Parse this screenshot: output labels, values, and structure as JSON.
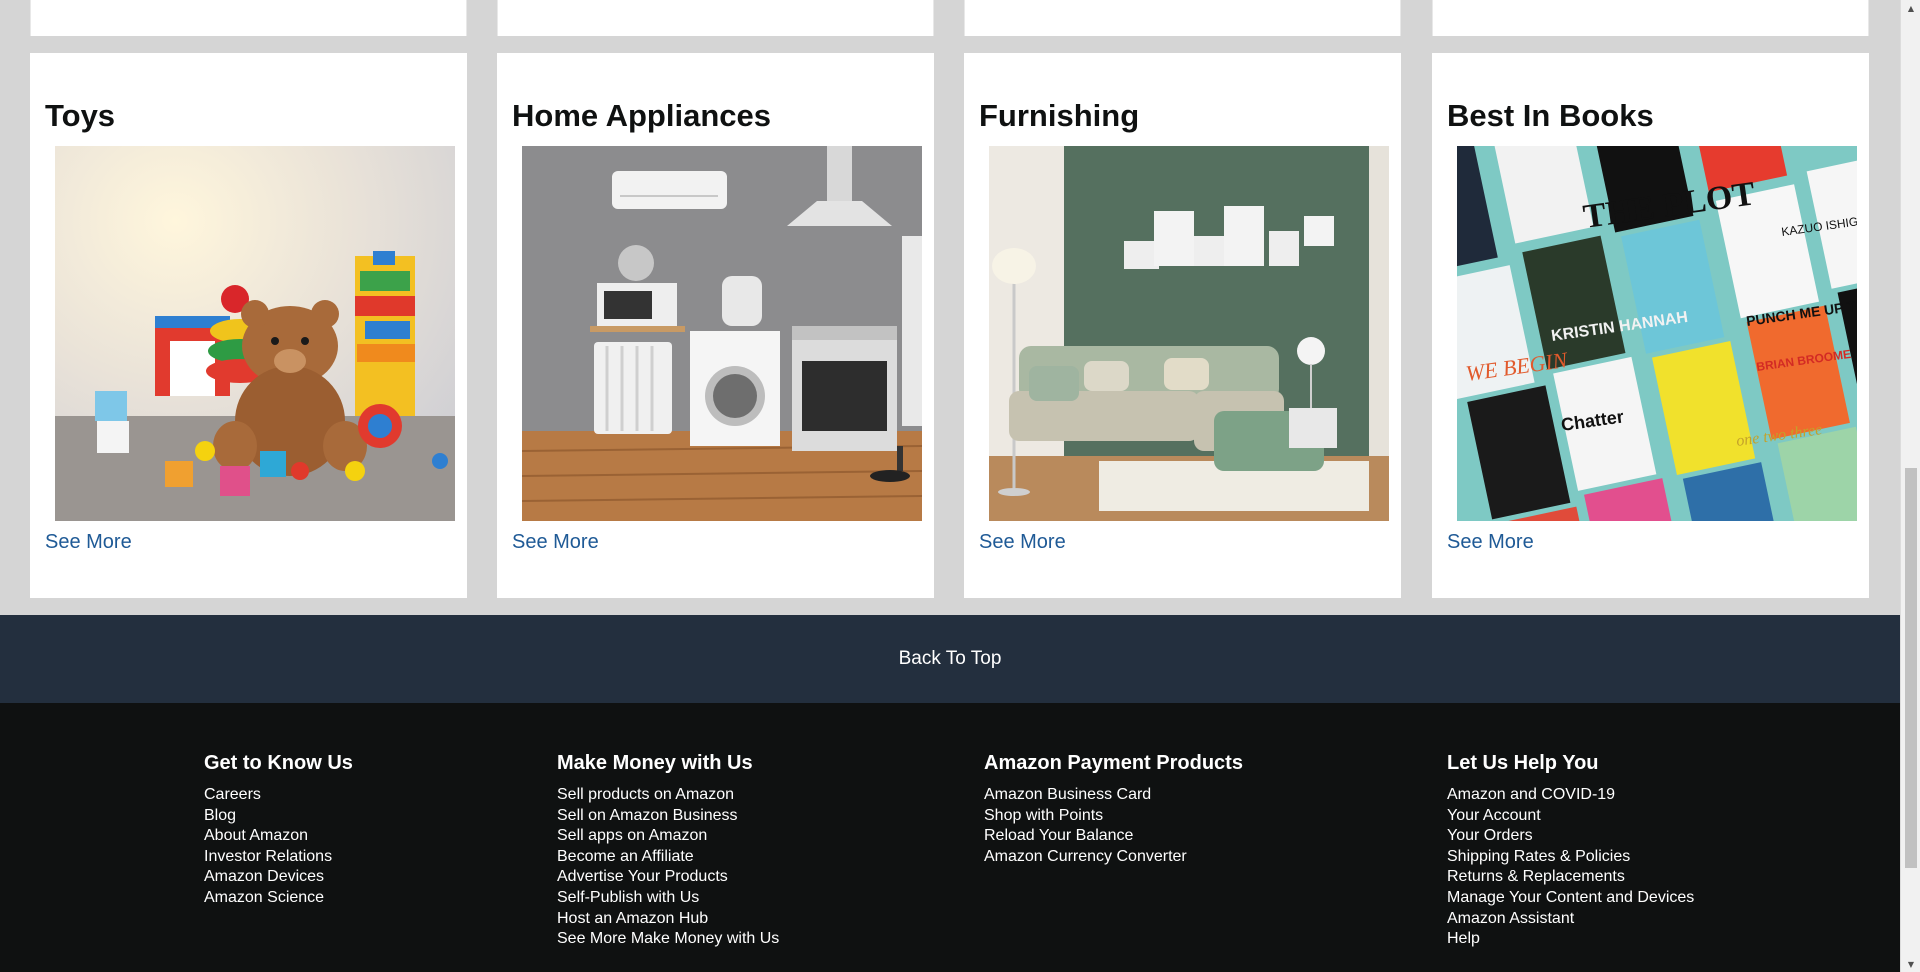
{
  "cards": [
    {
      "title": "Toys",
      "link": "See More",
      "image": "toys-photo"
    },
    {
      "title": "Home Appliances",
      "link": "See More",
      "image": "appliances-photo"
    },
    {
      "title": "Furnishing",
      "link": "See More",
      "image": "living-room-photo"
    },
    {
      "title": "Best In Books",
      "link": "See More",
      "image": "book-covers-photo"
    }
  ],
  "back_to_top": "Back To Top",
  "footer": {
    "columns": [
      {
        "heading": "Get to Know Us",
        "links": [
          "Careers",
          "Blog",
          "About Amazon",
          "Investor Relations",
          "Amazon Devices",
          "Amazon Science"
        ]
      },
      {
        "heading": "Make Money with Us",
        "links": [
          "Sell products on Amazon",
          "Sell on Amazon Business",
          "Sell apps on Amazon",
          "Become an Affiliate",
          "Advertise Your Products",
          "Self-Publish with Us",
          "Host an Amazon Hub",
          "See More Make Money with Us"
        ]
      },
      {
        "heading": "Amazon Payment Products",
        "links": [
          "Amazon Business Card",
          "Shop with Points",
          "Reload Your Balance",
          "Amazon Currency Converter"
        ]
      },
      {
        "heading": "Let Us Help You",
        "links": [
          "Amazon and COVID-19",
          "Your Account",
          "Your Orders",
          "Shipping Rates & Policies",
          "Returns & Replacements",
          "Manage Your Content and Devices",
          "Amazon Assistant",
          "Help"
        ]
      }
    ]
  },
  "book_cover_text": [
    "THE PLOT",
    "KRISTIN HANNAH",
    "PUNCH ME UP TO THE GODS",
    "WE BEGIN",
    "Chatter",
    "KAZUO ISHIGURO",
    "one two three",
    "BRIAN BROOME"
  ],
  "colors": {
    "link": "#1f5a96",
    "back_to_top_bg": "#232f3e",
    "footer_bg": "#0f1111",
    "page_bg": "#d5d5d5"
  }
}
